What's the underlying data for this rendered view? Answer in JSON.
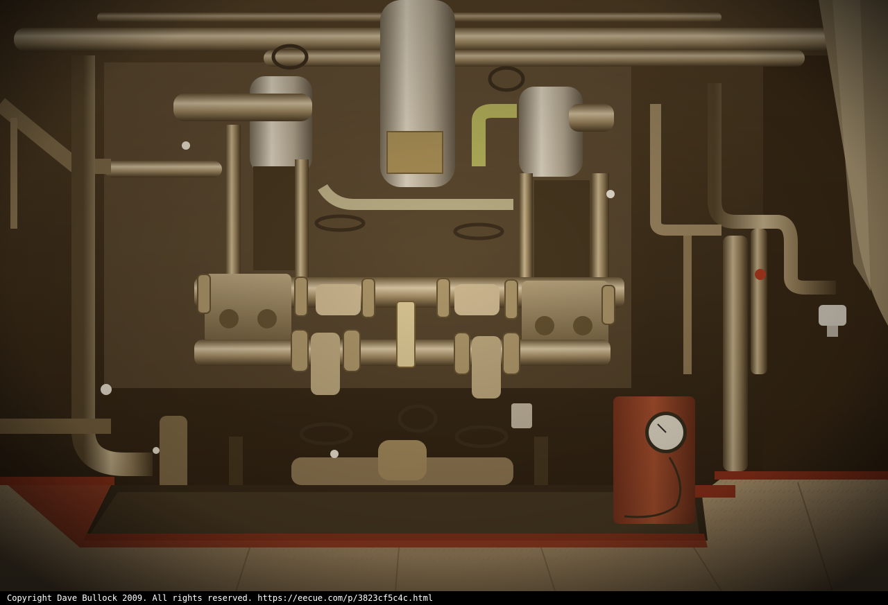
{
  "photo": {
    "subject": "boiler-room-valve-manifold",
    "palette": {
      "background_dark": "#1c140b",
      "pipe_warm": "#9a8663",
      "pipe_highlight": "#d6c7a8",
      "floor_plate": "#a48e6c",
      "red_trim": "#8a2a16",
      "gauge_case": "#8e3a22",
      "gauge_face": "#e8e2d4"
    }
  },
  "caption": {
    "text": "Copyright Dave Bullock 2009. All rights reserved. https://eecue.com/p/3823cf5c4c.html"
  }
}
